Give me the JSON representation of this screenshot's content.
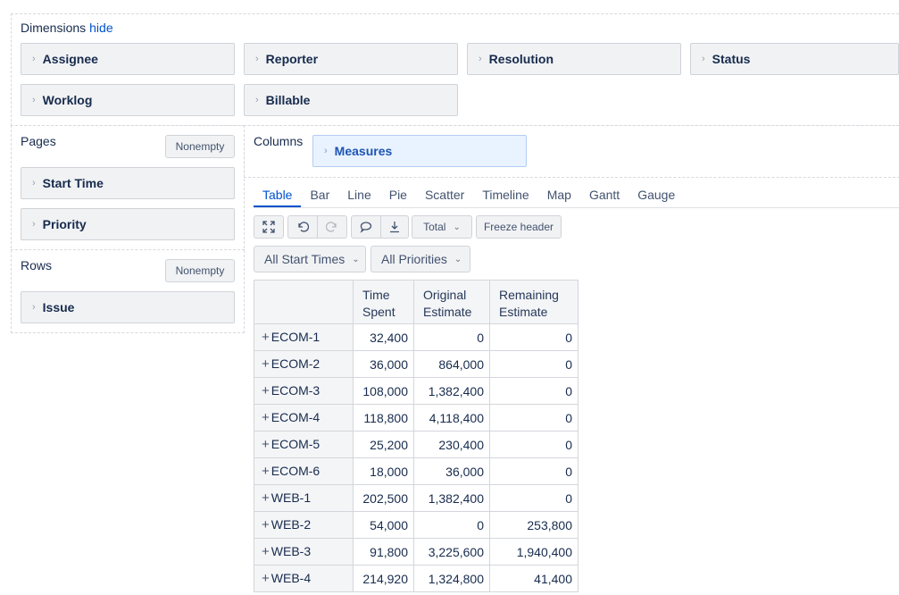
{
  "dimensions": {
    "title": "Dimensions",
    "hide_label": "hide",
    "items": [
      "Assignee",
      "Reporter",
      "Resolution",
      "Status",
      "Worklog",
      "Billable"
    ]
  },
  "pages": {
    "title": "Pages",
    "nonempty_label": "Nonempty",
    "items": [
      "Start Time",
      "Priority"
    ]
  },
  "rows": {
    "title": "Rows",
    "nonempty_label": "Nonempty",
    "items": [
      "Issue"
    ]
  },
  "columns": {
    "title": "Columns",
    "items": [
      "Measures"
    ]
  },
  "view_tabs": {
    "items": [
      "Table",
      "Bar",
      "Line",
      "Pie",
      "Scatter",
      "Timeline",
      "Map",
      "Gantt",
      "Gauge"
    ],
    "active": "Table"
  },
  "toolbar": {
    "total_label": "Total",
    "freeze_label": "Freeze header",
    "icons": [
      "fullscreen-icon",
      "undo-icon",
      "redo-icon",
      "comment-icon",
      "export-icon"
    ]
  },
  "filters": {
    "start_times": "All Start Times",
    "priorities": "All Priorities"
  },
  "table": {
    "headers": [
      "",
      "Time Spent",
      "Original Estimate",
      "Remaining Estimate"
    ],
    "rows": [
      [
        "ECOM-1",
        "32,400",
        "0",
        "0"
      ],
      [
        "ECOM-2",
        "36,000",
        "864,000",
        "0"
      ],
      [
        "ECOM-3",
        "108,000",
        "1,382,400",
        "0"
      ],
      [
        "ECOM-4",
        "118,800",
        "4,118,400",
        "0"
      ],
      [
        "ECOM-5",
        "25,200",
        "230,400",
        "0"
      ],
      [
        "ECOM-6",
        "18,000",
        "36,000",
        "0"
      ],
      [
        "WEB-1",
        "202,500",
        "1,382,400",
        "0"
      ],
      [
        "WEB-2",
        "54,000",
        "0",
        "253,800"
      ],
      [
        "WEB-3",
        "91,800",
        "3,225,600",
        "1,940,400"
      ],
      [
        "WEB-4",
        "214,920",
        "1,324,800",
        "41,400"
      ]
    ]
  }
}
